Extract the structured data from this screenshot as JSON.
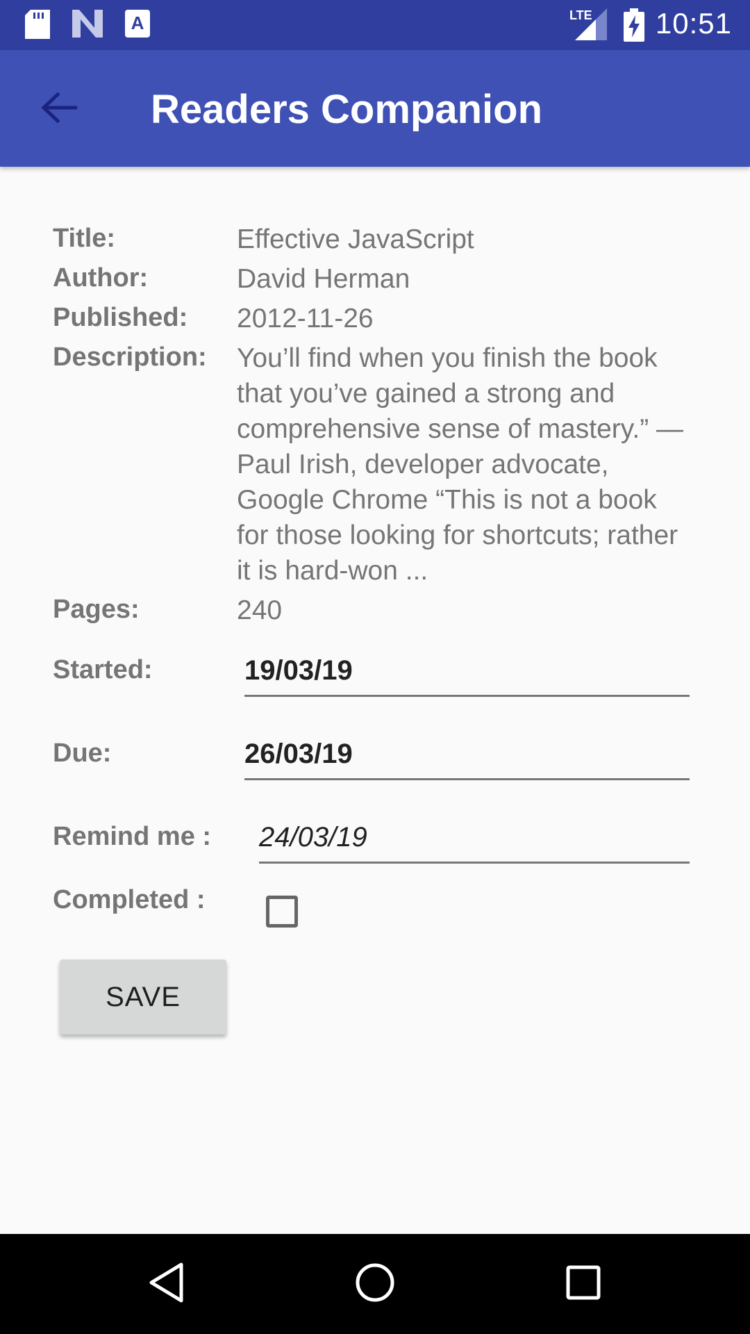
{
  "status_bar": {
    "time": "10:51",
    "network": "LTE",
    "icons": [
      "sd-card-icon",
      "n-icon",
      "a-icon",
      "lte-signal-icon",
      "battery-charging-icon"
    ]
  },
  "app_bar": {
    "title": "Readers Companion",
    "back_icon": "arrow-back-icon"
  },
  "book": {
    "title_label": "Title:",
    "title": "Effective JavaScript",
    "author_label": "Author:",
    "author": "David Herman",
    "published_label": "Published:",
    "published": "2012-11-26",
    "description_label": "Description:",
    "description": "You’ll find when you finish the book that you’ve gained a strong and comprehensive sense of mastery.” — Paul Irish, developer advocate, Google Chrome “This is not a book for those looking for shortcuts; rather it is hard-won ...",
    "pages_label": "Pages:",
    "pages": "240"
  },
  "form": {
    "started_label": "Started:",
    "started": "19/03/19",
    "due_label": "Due:",
    "due": "26/03/19",
    "remind_label": "Remind me :",
    "remind": "24/03/19",
    "completed_label": "Completed :",
    "completed": false,
    "save_label": "SAVE"
  },
  "nav_bar": {
    "icons": [
      "nav-back-icon",
      "nav-home-icon",
      "nav-recents-icon"
    ]
  },
  "colors": {
    "status_bar": "#303f9f",
    "app_bar": "#3f51b5",
    "background": "#fafafa",
    "button": "#d6d7d7"
  }
}
